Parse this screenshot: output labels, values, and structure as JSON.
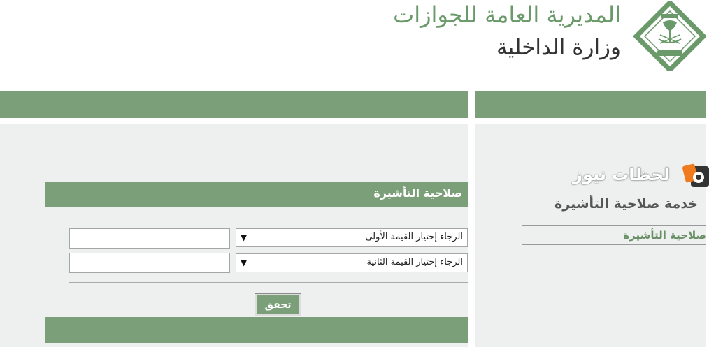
{
  "header": {
    "org_title": "المديرية العامة للجوازات",
    "ministry_title": "وزارة الداخلية",
    "emblem_icon": "passport-directorate-emblem-icon",
    "brand_color": "#7b9f78"
  },
  "sidebar": {
    "watermark_text": "لحظات نيوز",
    "watermark_icon": "camera-badge-icon",
    "service_title": "خدمة صلاحية التأشيرة",
    "items": [
      {
        "label": "صلاحية التأشيرة"
      }
    ]
  },
  "form": {
    "section_title": "صلاحية التأشيرة",
    "select_first": {
      "value": "الرجاء إختيار القيمة الأولى"
    },
    "select_second": {
      "value": "الرجاء إختيار القيمة الثانية"
    },
    "input_first": {
      "value": ""
    },
    "input_second": {
      "value": ""
    },
    "verify_label": "تحقق"
  },
  "colors": {
    "green_bar": "#7b9f78",
    "panel_bg": "#eef0ef",
    "title_green": "#6a9a6a"
  }
}
